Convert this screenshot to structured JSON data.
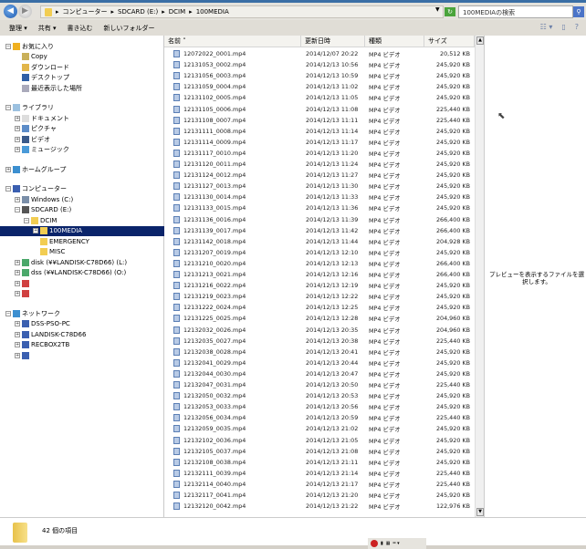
{
  "address": {
    "path": [
      "コンピューター",
      "SDCARD (E:)",
      "DCIM",
      "100MEDIA"
    ],
    "search_placeholder": "100MEDIAの検索"
  },
  "toolbar": {
    "organize": "整理 ▾",
    "share": "共有 ▾",
    "burn": "書き込む",
    "new_folder": "新しいフォルダー"
  },
  "nav": [
    {
      "label": "お気に入り",
      "level": 0,
      "exp": "−",
      "icon": "star-icon",
      "color": "#f0b020"
    },
    {
      "label": "Copy",
      "level": 1,
      "icon": "folder-icon",
      "color": "#c9b05a"
    },
    {
      "label": "ダウンロード",
      "level": 1,
      "icon": "download-icon",
      "color": "#e2b64a"
    },
    {
      "label": "デスクトップ",
      "level": 1,
      "icon": "desktop-icon",
      "color": "#2f5fa6"
    },
    {
      "label": "最近表示した場所",
      "level": 1,
      "icon": "recent-icon",
      "color": "#aab"
    },
    {
      "gap": true
    },
    {
      "label": "ライブラリ",
      "level": 0,
      "exp": "−",
      "icon": "library-icon",
      "color": "#9cc1e0"
    },
    {
      "label": "ドキュメント",
      "level": 1,
      "exp": "+",
      "icon": "document-icon",
      "color": "#ddd"
    },
    {
      "label": "ピクチャ",
      "level": 1,
      "exp": "+",
      "icon": "pictures-icon",
      "color": "#5c8cc8"
    },
    {
      "label": "ビデオ",
      "level": 1,
      "exp": "+",
      "icon": "video-icon",
      "color": "#3a5a8a"
    },
    {
      "label": "ミュージック",
      "level": 1,
      "exp": "+",
      "icon": "music-icon",
      "color": "#4a9ad8"
    },
    {
      "gap": true
    },
    {
      "label": "ホームグループ",
      "level": 0,
      "exp": "+",
      "icon": "homegroup-icon",
      "color": "#3c8fd0"
    },
    {
      "gap": true
    },
    {
      "label": "コンピューター",
      "level": 0,
      "exp": "−",
      "icon": "computer-icon",
      "color": "#3a5fb0"
    },
    {
      "label": "Windows (C:)",
      "level": 1,
      "exp": "+",
      "icon": "drive-icon",
      "color": "#7a8ea8"
    },
    {
      "label": "SDCARD (E:)",
      "level": 1,
      "exp": "−",
      "icon": "sdcard-icon",
      "color": "#555"
    },
    {
      "label": "DCIM",
      "level": 2,
      "exp": "−",
      "icon": "folder-icon",
      "color": "#f2cd52"
    },
    {
      "label": "100MEDIA",
      "level": 3,
      "exp": "+",
      "icon": "folder-icon",
      "color": "#f2cd52",
      "selected": true
    },
    {
      "label": "EMERGENCY",
      "level": 3,
      "icon": "folder-icon",
      "color": "#f2cd52"
    },
    {
      "label": "MISC",
      "level": 3,
      "icon": "folder-icon",
      "color": "#f2cd52"
    },
    {
      "label": "disk (¥¥LANDISK-C78D66) (L:)",
      "level": 1,
      "exp": "+",
      "icon": "network-drive-icon",
      "color": "#4aa86a"
    },
    {
      "label": "dss (¥¥LANDISK-C78D66) (O:)",
      "level": 1,
      "exp": "+",
      "icon": "network-drive-icon",
      "color": "#4aa86a"
    },
    {
      "label": "",
      "level": 1,
      "exp": "+",
      "icon": "disconnected-drive-icon",
      "color": "#d04040"
    },
    {
      "label": "",
      "level": 1,
      "exp": "+",
      "icon": "disconnected-drive-icon",
      "color": "#d04040"
    },
    {
      "gap": true
    },
    {
      "label": "ネットワーク",
      "level": 0,
      "exp": "−",
      "icon": "network-icon",
      "color": "#3c8fd0"
    },
    {
      "label": "DSS-PSO-PC",
      "level": 1,
      "exp": "+",
      "icon": "pc-icon",
      "color": "#3a5fb0"
    },
    {
      "label": "LANDISK-C78D66",
      "level": 1,
      "exp": "+",
      "icon": "pc-icon",
      "color": "#3a5fb0"
    },
    {
      "label": "RECBOX2TB",
      "level": 1,
      "exp": "+",
      "icon": "pc-icon",
      "color": "#3a5fb0"
    },
    {
      "label": "",
      "level": 1,
      "exp": "+",
      "icon": "pc-icon",
      "color": "#3a5fb0"
    }
  ],
  "columns": [
    "名前",
    "更新日時",
    "種類",
    "サイズ"
  ],
  "files": [
    [
      "12072022_0001.mp4",
      "2014/12/07 20:22",
      "MP4 ビデオ",
      "20,512 KB"
    ],
    [
      "12131053_0002.mp4",
      "2014/12/13 10:56",
      "MP4 ビデオ",
      "245,920 KB"
    ],
    [
      "12131056_0003.mp4",
      "2014/12/13 10:59",
      "MP4 ビデオ",
      "245,920 KB"
    ],
    [
      "12131059_0004.mp4",
      "2014/12/13 11:02",
      "MP4 ビデオ",
      "245,920 KB"
    ],
    [
      "12131102_0005.mp4",
      "2014/12/13 11:05",
      "MP4 ビデオ",
      "245,920 KB"
    ],
    [
      "12131105_0006.mp4",
      "2014/12/13 11:08",
      "MP4 ビデオ",
      "225,440 KB"
    ],
    [
      "12131108_0007.mp4",
      "2014/12/13 11:11",
      "MP4 ビデオ",
      "225,440 KB"
    ],
    [
      "12131111_0008.mp4",
      "2014/12/13 11:14",
      "MP4 ビデオ",
      "245,920 KB"
    ],
    [
      "12131114_0009.mp4",
      "2014/12/13 11:17",
      "MP4 ビデオ",
      "245,920 KB"
    ],
    [
      "12131117_0010.mp4",
      "2014/12/13 11:20",
      "MP4 ビデオ",
      "245,920 KB"
    ],
    [
      "12131120_0011.mp4",
      "2014/12/13 11:24",
      "MP4 ビデオ",
      "245,920 KB"
    ],
    [
      "12131124_0012.mp4",
      "2014/12/13 11:27",
      "MP4 ビデオ",
      "245,920 KB"
    ],
    [
      "12131127_0013.mp4",
      "2014/12/13 11:30",
      "MP4 ビデオ",
      "245,920 KB"
    ],
    [
      "12131130_0014.mp4",
      "2014/12/13 11:33",
      "MP4 ビデオ",
      "245,920 KB"
    ],
    [
      "12131133_0015.mp4",
      "2014/12/13 11:36",
      "MP4 ビデオ",
      "245,920 KB"
    ],
    [
      "12131136_0016.mp4",
      "2014/12/13 11:39",
      "MP4 ビデオ",
      "266,400 KB"
    ],
    [
      "12131139_0017.mp4",
      "2014/12/13 11:42",
      "MP4 ビデオ",
      "266,400 KB"
    ],
    [
      "12131142_0018.mp4",
      "2014/12/13 11:44",
      "MP4 ビデオ",
      "204,928 KB"
    ],
    [
      "12131207_0019.mp4",
      "2014/12/13 12:10",
      "MP4 ビデオ",
      "245,920 KB"
    ],
    [
      "12131210_0020.mp4",
      "2014/12/13 12:13",
      "MP4 ビデオ",
      "266,400 KB"
    ],
    [
      "12131213_0021.mp4",
      "2014/12/13 12:16",
      "MP4 ビデオ",
      "266,400 KB"
    ],
    [
      "12131216_0022.mp4",
      "2014/12/13 12:19",
      "MP4 ビデオ",
      "245,920 KB"
    ],
    [
      "12131219_0023.mp4",
      "2014/12/13 12:22",
      "MP4 ビデオ",
      "245,920 KB"
    ],
    [
      "12131222_0024.mp4",
      "2014/12/13 12:25",
      "MP4 ビデオ",
      "245,920 KB"
    ],
    [
      "12131225_0025.mp4",
      "2014/12/13 12:28",
      "MP4 ビデオ",
      "204,960 KB"
    ],
    [
      "12132032_0026.mp4",
      "2014/12/13 20:35",
      "MP4 ビデオ",
      "204,960 KB"
    ],
    [
      "12132035_0027.mp4",
      "2014/12/13 20:38",
      "MP4 ビデオ",
      "225,440 KB"
    ],
    [
      "12132038_0028.mp4",
      "2014/12/13 20:41",
      "MP4 ビデオ",
      "245,920 KB"
    ],
    [
      "12132041_0029.mp4",
      "2014/12/13 20:44",
      "MP4 ビデオ",
      "245,920 KB"
    ],
    [
      "12132044_0030.mp4",
      "2014/12/13 20:47",
      "MP4 ビデオ",
      "245,920 KB"
    ],
    [
      "12132047_0031.mp4",
      "2014/12/13 20:50",
      "MP4 ビデオ",
      "225,440 KB"
    ],
    [
      "12132050_0032.mp4",
      "2014/12/13 20:53",
      "MP4 ビデオ",
      "245,920 KB"
    ],
    [
      "12132053_0033.mp4",
      "2014/12/13 20:56",
      "MP4 ビデオ",
      "245,920 KB"
    ],
    [
      "12132056_0034.mp4",
      "2014/12/13 20:59",
      "MP4 ビデオ",
      "225,440 KB"
    ],
    [
      "12132059_0035.mp4",
      "2014/12/13 21:02",
      "MP4 ビデオ",
      "245,920 KB"
    ],
    [
      "12132102_0036.mp4",
      "2014/12/13 21:05",
      "MP4 ビデオ",
      "245,920 KB"
    ],
    [
      "12132105_0037.mp4",
      "2014/12/13 21:08",
      "MP4 ビデオ",
      "245,920 KB"
    ],
    [
      "12132108_0038.mp4",
      "2014/12/13 21:11",
      "MP4 ビデオ",
      "245,920 KB"
    ],
    [
      "12132111_0039.mp4",
      "2014/12/13 21:14",
      "MP4 ビデオ",
      "225,440 KB"
    ],
    [
      "12132114_0040.mp4",
      "2014/12/13 21:17",
      "MP4 ビデオ",
      "225,440 KB"
    ],
    [
      "12132117_0041.mp4",
      "2014/12/13 21:20",
      "MP4 ビデオ",
      "245,920 KB"
    ],
    [
      "12132120_0042.mp4",
      "2014/12/13 21:22",
      "MP4 ビデオ",
      "122,976 KB"
    ]
  ],
  "preview_text": "プレビューを表示するファイルを選択します。",
  "status": {
    "count": "42 個の項目"
  }
}
